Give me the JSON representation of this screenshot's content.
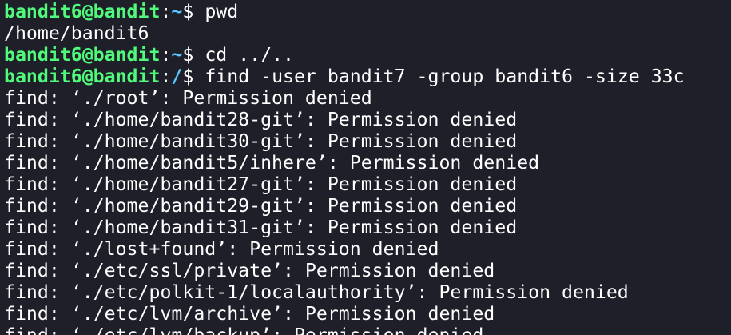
{
  "terminal": {
    "prompt_user": "bandit6@bandit",
    "prompt_symbol": "$ ",
    "lines": [
      {
        "type": "prompt",
        "path": "~",
        "command": "pwd"
      },
      {
        "type": "output",
        "text": "/home/bandit6"
      },
      {
        "type": "prompt",
        "path": "~",
        "command": "cd ../.."
      },
      {
        "type": "prompt",
        "path": "/",
        "command": "find -user bandit7 -group bandit6 -size 33c"
      },
      {
        "type": "output",
        "text": "find: ‘./root’: Permission denied"
      },
      {
        "type": "output",
        "text": "find: ‘./home/bandit28-git’: Permission denied"
      },
      {
        "type": "output",
        "text": "find: ‘./home/bandit30-git’: Permission denied"
      },
      {
        "type": "output",
        "text": "find: ‘./home/bandit5/inhere’: Permission denied"
      },
      {
        "type": "output",
        "text": "find: ‘./home/bandit27-git’: Permission denied"
      },
      {
        "type": "output",
        "text": "find: ‘./home/bandit29-git’: Permission denied"
      },
      {
        "type": "output",
        "text": "find: ‘./home/bandit31-git’: Permission denied"
      },
      {
        "type": "output",
        "text": "find: ‘./lost+found’: Permission denied"
      },
      {
        "type": "output",
        "text": "find: ‘./etc/ssl/private’: Permission denied"
      },
      {
        "type": "output",
        "text": "find: ‘./etc/polkit-1/localauthority’: Permission denied"
      },
      {
        "type": "output",
        "text": "find: ‘./etc/lvm/archive’: Permission denied"
      },
      {
        "type": "output",
        "text": "find: ‘./etc/lvm/backup’: Permission denied"
      }
    ]
  },
  "colors": {
    "background": "#1e1f29",
    "prompt_user": "#50fa7b",
    "prompt_path": "#57c7ff",
    "text": "#ffffff"
  }
}
